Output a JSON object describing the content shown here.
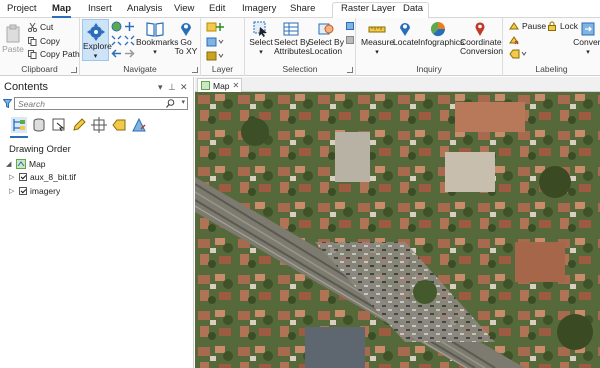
{
  "ribbon_tabs": [
    {
      "label": "Project",
      "active": false
    },
    {
      "label": "Map",
      "active": true
    },
    {
      "label": "Insert",
      "active": false
    },
    {
      "label": "Analysis",
      "active": false
    },
    {
      "label": "View",
      "active": false
    },
    {
      "label": "Edit",
      "active": false
    },
    {
      "label": "Imagery",
      "active": false
    },
    {
      "label": "Share",
      "active": false
    },
    {
      "label": "Raster Layer",
      "active": false
    },
    {
      "label": "Data",
      "active": false
    }
  ],
  "clipboard": {
    "paste": "Paste",
    "cut": "Cut",
    "copy": "Copy",
    "copy_path": "Copy Path",
    "label": "Clipboard"
  },
  "navigate": {
    "explore": "Explore",
    "bookmarks": "Bookmarks",
    "go_to_xy_1": "Go",
    "go_to_xy_2": "To XY",
    "label": "Navigate"
  },
  "layer": {
    "label": "Layer"
  },
  "selection": {
    "select": "Select",
    "by_attr_1": "Select By",
    "by_attr_2": "Attributes",
    "by_loc_1": "Select By",
    "by_loc_2": "Location",
    "label": "Selection"
  },
  "inquiry": {
    "measure": "Measure",
    "locate": "Locate",
    "infographics": "Infographics",
    "coord_1": "Coordinate",
    "coord_2": "Conversion",
    "label": "Inquiry"
  },
  "labeling": {
    "pause": "Pause",
    "lock": "Lock",
    "convert": "Convert",
    "label": "Labeling"
  },
  "contents": {
    "title": "Contents",
    "search_placeholder": "Search",
    "drawing_order": "Drawing Order",
    "map_name": "Map",
    "layers": [
      {
        "name": "aux_8_bit.tif",
        "checked": true
      },
      {
        "name": "imagery",
        "checked": true
      }
    ]
  },
  "map_view": {
    "tab_label": "Map"
  },
  "colors": {
    "accent": "#2a6ebb",
    "ribbon_bg": "#fafafa",
    "explore_bg": "#cde3f7"
  }
}
